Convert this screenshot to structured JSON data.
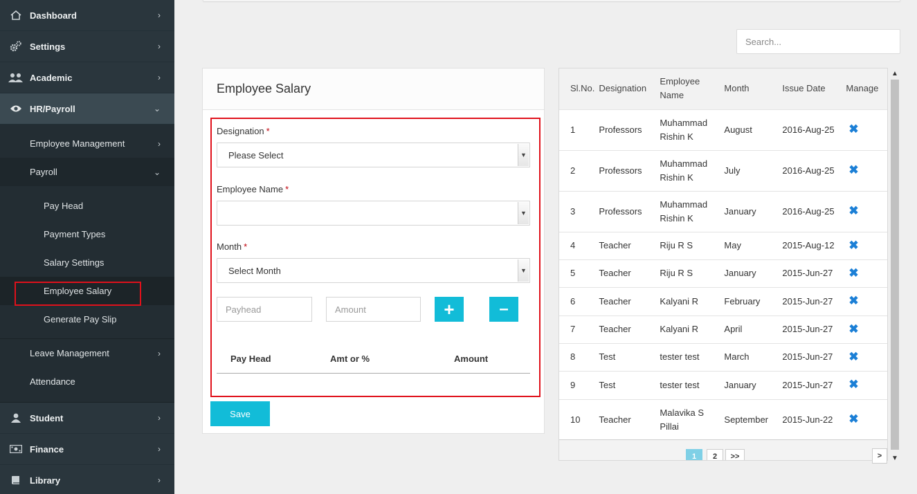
{
  "sidebar": {
    "items": [
      {
        "label": "Dashboard",
        "icon": "home-icon"
      },
      {
        "label": "Settings",
        "icon": "gears-icon"
      },
      {
        "label": "Academic",
        "icon": "users-icon"
      },
      {
        "label": "HR/Payroll",
        "icon": "eye-icon"
      }
    ],
    "hr_sub": {
      "employee_management": "Employee Management",
      "payroll": "Payroll",
      "payroll_items": [
        "Pay Head",
        "Payment Types",
        "Salary Settings",
        "Employee Salary",
        "Generate Pay Slip"
      ],
      "leave_management": "Leave Management",
      "attendance": "Attendance"
    },
    "bottom_items": [
      {
        "label": "Student",
        "icon": "user-icon"
      },
      {
        "label": "Finance",
        "icon": "money-icon"
      },
      {
        "label": "Library",
        "icon": "book-icon"
      }
    ]
  },
  "search": {
    "placeholder": "Search..."
  },
  "form": {
    "title": "Employee Salary",
    "designation_label": "Designation",
    "designation_value": "Please Select",
    "employee_label": "Employee Name",
    "employee_value": "",
    "month_label": "Month",
    "month_value": "Select Month",
    "required_mark": "*",
    "payhead_placeholder": "Payhead",
    "amount_placeholder": "Amount",
    "add_label": "+",
    "remove_label": "–",
    "table_headers": [
      "Pay Head",
      "Amt or %",
      "Amount"
    ],
    "save_label": "Save"
  },
  "table": {
    "headers": [
      "Sl.No.",
      "Designation",
      "Employee Name",
      "Month",
      "Issue Date",
      "Manage"
    ],
    "rows": [
      [
        "1",
        "Professors",
        "Muhammad Rishin K",
        "August",
        "2016-Aug-25"
      ],
      [
        "2",
        "Professors",
        "Muhammad Rishin K",
        "July",
        "2016-Aug-25"
      ],
      [
        "3",
        "Professors",
        "Muhammad Rishin K",
        "January",
        "2016-Aug-25"
      ],
      [
        "4",
        "Teacher",
        "Riju R S",
        "May",
        "2015-Aug-12"
      ],
      [
        "5",
        "Teacher",
        "Riju R S",
        "January",
        "2015-Jun-27"
      ],
      [
        "6",
        "Teacher",
        "Kalyani R",
        "February",
        "2015-Jun-27"
      ],
      [
        "7",
        "Teacher",
        "Kalyani R",
        "April",
        "2015-Jun-27"
      ],
      [
        "8",
        "Test",
        "tester test",
        "March",
        "2015-Jun-27"
      ],
      [
        "9",
        "Test",
        "tester test",
        "January",
        "2015-Jun-27"
      ],
      [
        "10",
        "Teacher",
        "Malavika S Pillai",
        "September",
        "2015-Jun-22"
      ]
    ],
    "delete_icon": "close-icon"
  },
  "pagination": {
    "pages": [
      "1",
      "2",
      ">>"
    ],
    "next": ">"
  },
  "colors": {
    "sidebar": "#2a363d",
    "accent": "#12bcd8",
    "highlight": "#e0111b",
    "delete": "#1b7fd6"
  }
}
